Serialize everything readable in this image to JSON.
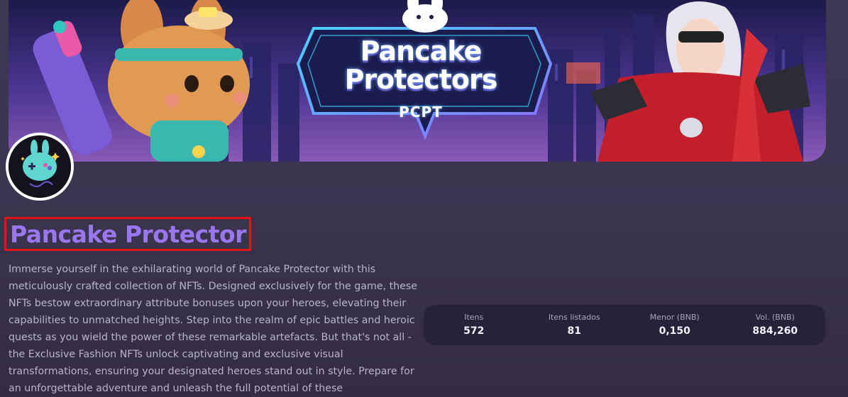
{
  "banner": {
    "title": "Pancake Protectors",
    "subtitle": "PCPT"
  },
  "collection": {
    "name": "Pancake Protector",
    "description": "Immerse yourself in the exhilarating world of Pancake Protector with this meticulously crafted collection of NFTs. Designed exclusively for the game, these NFTs bestow extraordinary attribute bonuses upon your heroes, elevating their capabilities to unmatched heights. Step into the realm of epic battles and heroic quests as you wield the power of these remarkable artefacts. But that's not all - the Exclusive Fashion NFTs unlock captivating and exclusive visual transformations, ensuring your designated heroes stand out in style. Prepare for an unforgettable adventure and unleash the full potential of these"
  },
  "stats": [
    {
      "label": "Itens",
      "value": "572"
    },
    {
      "label": "Itens listados",
      "value": "81"
    },
    {
      "label": "Menor (BNB)",
      "value": "0,150"
    },
    {
      "label": "Vol. (BNB)",
      "value": "884,260"
    }
  ],
  "colors": {
    "title": "#9a77f0",
    "highlight_border": "#e3131b",
    "stats_bg": "#27223a"
  },
  "icons": {
    "avatar": "bunny-gamepad-icon"
  }
}
